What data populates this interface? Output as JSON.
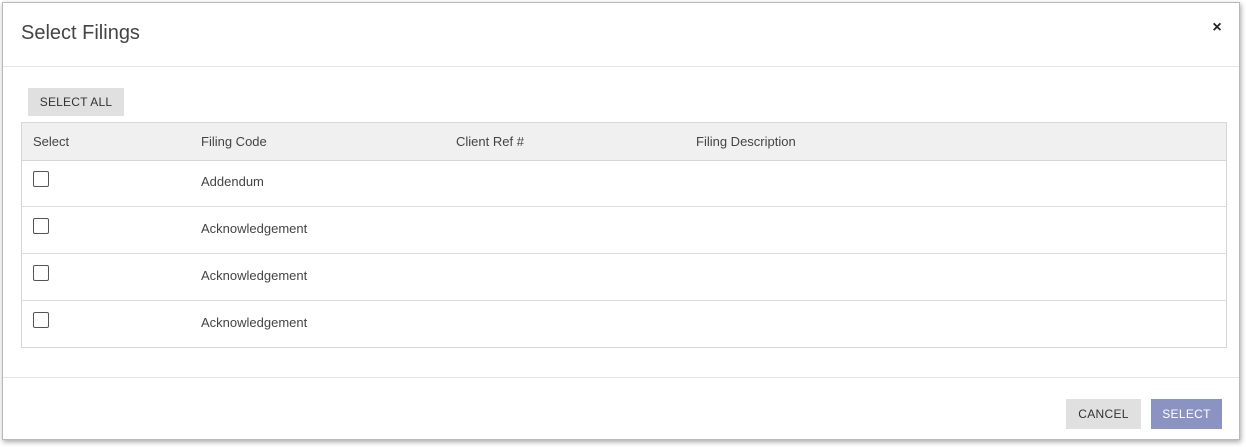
{
  "dialog": {
    "title": "Select Filings",
    "close_glyph": "×"
  },
  "toolbar": {
    "select_all_label": "SELECT ALL"
  },
  "table": {
    "columns": [
      "Select",
      "Filing Code",
      "Client Ref #",
      "Filing Description"
    ],
    "rows": [
      {
        "checked": false,
        "filing_code": "Addendum",
        "client_ref": "",
        "description": ""
      },
      {
        "checked": false,
        "filing_code": "Acknowledgement",
        "client_ref": "",
        "description": ""
      },
      {
        "checked": false,
        "filing_code": "Acknowledgement",
        "client_ref": "",
        "description": ""
      },
      {
        "checked": false,
        "filing_code": "Acknowledgement",
        "client_ref": "",
        "description": ""
      }
    ]
  },
  "footer": {
    "cancel_label": "CANCEL",
    "select_label": "SELECT"
  },
  "colors": {
    "primary_button": "#8b93c2",
    "secondary_button": "#e0e0e0",
    "table_header_bg": "#f0f0f0"
  },
  "icons": {
    "close": "close-icon",
    "checkbox": "checkbox-unchecked"
  }
}
